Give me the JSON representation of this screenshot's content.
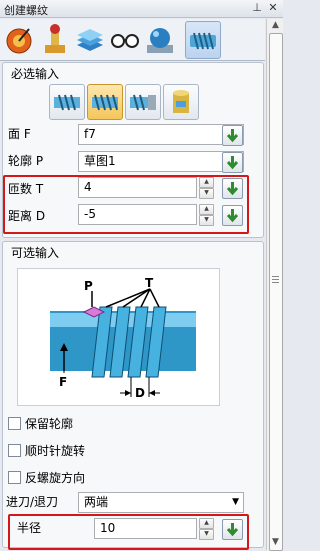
{
  "window": {
    "title": "创建螺纹",
    "pin_icon": "pin-icon",
    "close_icon": "close-icon"
  },
  "tabs": [
    {
      "name": "feature-tab",
      "active": false
    },
    {
      "name": "pattern-tab",
      "active": false
    },
    {
      "name": "layers-tab",
      "active": false
    },
    {
      "name": "view-tab",
      "active": false
    },
    {
      "name": "sphere-tab",
      "active": false
    },
    {
      "name": "thread-tab",
      "active": true
    }
  ],
  "required": {
    "title": "必选输入",
    "face": {
      "label": "面 F",
      "value": "f7"
    },
    "profile": {
      "label": "轮廓 P",
      "value": "草图1"
    },
    "count": {
      "label": "匝数 T",
      "value": "4"
    },
    "distance": {
      "label": "距离 D",
      "value": "-5"
    }
  },
  "optional": {
    "title": "可选输入",
    "diagram_labels": {
      "p": "P",
      "t": "T",
      "f": "F",
      "d": "D"
    },
    "keep_profile": {
      "label": "保留轮廓",
      "checked": false
    },
    "clockwise": {
      "label": "顺时针旋转",
      "checked": false
    },
    "reverse": {
      "label": "反螺旋方向",
      "checked": false
    },
    "lead": {
      "label": "进刀/退刀",
      "value": "两端"
    },
    "radius": {
      "label": "半径",
      "value": "10"
    }
  },
  "colors": {
    "highlight_box": "#d21818",
    "accent_green": "#2e8b2e",
    "diagram_blue": "#3aa6d8"
  }
}
